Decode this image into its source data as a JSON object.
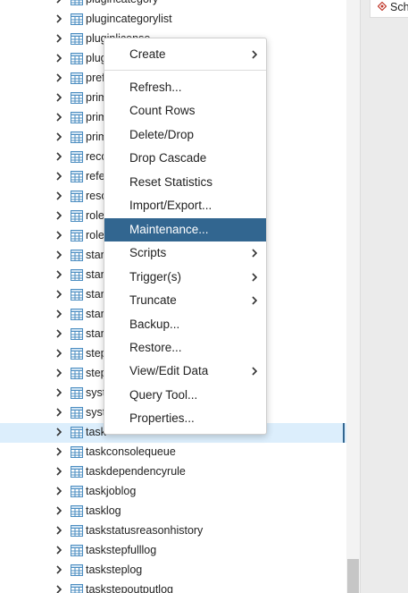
{
  "tree": {
    "rows": [
      {
        "label": "plugincategory"
      },
      {
        "label": "plugincategorylist"
      },
      {
        "label": "pluginlicense"
      },
      {
        "label": "plug"
      },
      {
        "label": "pref"
      },
      {
        "label": "prim"
      },
      {
        "label": "prim"
      },
      {
        "label": "prim"
      },
      {
        "label": "reco"
      },
      {
        "label": "refe"
      },
      {
        "label": "reso"
      },
      {
        "label": "role"
      },
      {
        "label": "role"
      },
      {
        "label": "stan"
      },
      {
        "label": "stan"
      },
      {
        "label": "stan"
      },
      {
        "label": "stan"
      },
      {
        "label": "stan"
      },
      {
        "label": "step"
      },
      {
        "label": "step"
      },
      {
        "label": "syst"
      },
      {
        "label": "syst"
      },
      {
        "label": "task"
      },
      {
        "label": "taskconsolequeue"
      },
      {
        "label": "taskdependencyrule"
      },
      {
        "label": "taskjoblog"
      },
      {
        "label": "tasklog"
      },
      {
        "label": "taskstatusreasonhistory"
      },
      {
        "label": "taskstepfulllog"
      },
      {
        "label": "tasksteplog"
      },
      {
        "label": "taskstepoutputlog"
      }
    ],
    "selected_label": "task"
  },
  "context_menu": {
    "items": [
      {
        "label": "Create",
        "submenu": true
      },
      {
        "label": "Refresh...",
        "submenu": false
      },
      {
        "label": "Count Rows",
        "submenu": false
      },
      {
        "label": "Delete/Drop",
        "submenu": false
      },
      {
        "label": "Drop Cascade",
        "submenu": false
      },
      {
        "label": "Reset Statistics",
        "submenu": false
      },
      {
        "label": "Import/Export...",
        "submenu": false
      },
      {
        "label": "Maintenance...",
        "submenu": false,
        "active": true
      },
      {
        "label": "Scripts",
        "submenu": true
      },
      {
        "label": "Trigger(s)",
        "submenu": true
      },
      {
        "label": "Truncate",
        "submenu": true
      },
      {
        "label": "Backup...",
        "submenu": false
      },
      {
        "label": "Restore...",
        "submenu": false
      },
      {
        "label": "View/Edit Data",
        "submenu": true
      },
      {
        "label": "Query Tool...",
        "submenu": false
      },
      {
        "label": "Properties...",
        "submenu": false
      }
    ]
  },
  "right_panel": {
    "tab_label": "Sch"
  },
  "colors": {
    "accent": "#326690",
    "selection_bg": "#dceefc",
    "table_icon": "#4a8cc0"
  }
}
